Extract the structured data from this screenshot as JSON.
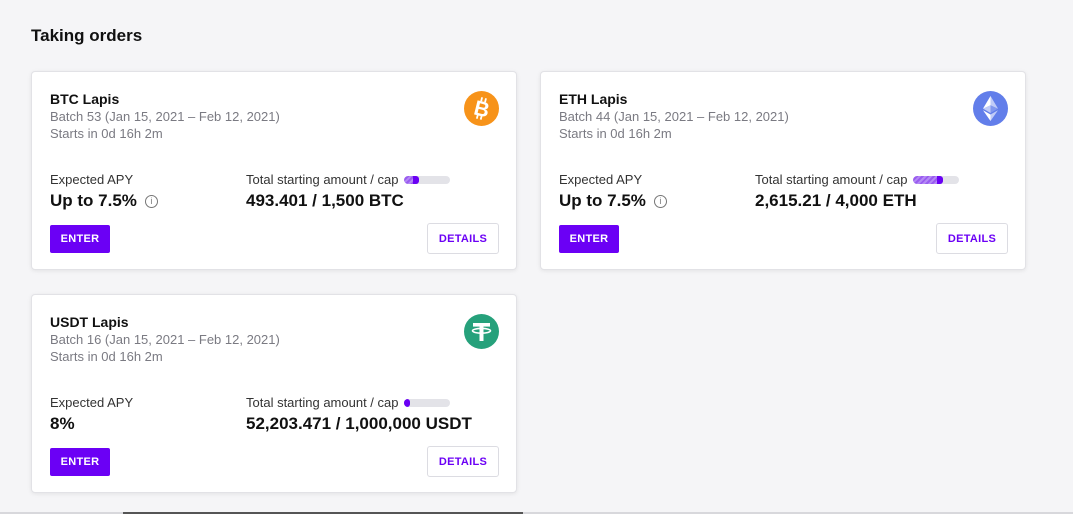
{
  "section": {
    "title": "Taking orders"
  },
  "cards": [
    {
      "name": "BTC Lapis",
      "batch": "Batch 53 (Jan 15, 2021 – Feb 12, 2021)",
      "starts": "Starts in 0d 16h 2m",
      "apy_label": "Expected APY",
      "apy_value": "Up to 7.5%",
      "cap_label": "Total starting amount / cap",
      "cap_value": "493.401 / 1,500 BTC",
      "progress_fraction": 0.33,
      "enter_label": "ENTER",
      "details_label": "DETAILS",
      "icon": "bitcoin-icon",
      "icon_color": "#f7931a",
      "show_info": true
    },
    {
      "name": "ETH Lapis",
      "batch": "Batch 44 (Jan 15, 2021 – Feb 12, 2021)",
      "starts": "Starts in 0d 16h 2m",
      "apy_label": "Expected APY",
      "apy_value": "Up to 7.5%",
      "cap_label": "Total starting amount / cap",
      "cap_value": "2,615.21 / 4,000 ETH",
      "progress_fraction": 0.65,
      "enter_label": "ENTER",
      "details_label": "DETAILS",
      "icon": "ethereum-icon",
      "icon_color": "#627eea",
      "show_info": true
    },
    {
      "name": "USDT Lapis",
      "batch": "Batch 16 (Jan 15, 2021 – Feb 12, 2021)",
      "starts": "Starts in 0d 16h 2m",
      "apy_label": "Expected APY",
      "apy_value": "8%",
      "cap_label": "Total starting amount / cap",
      "cap_value": "52,203.471 / 1,000,000 USDT",
      "progress_fraction": 0.052,
      "enter_label": "ENTER",
      "details_label": "DETAILS",
      "icon": "tether-icon",
      "icon_color": "#26a17b",
      "show_info": false
    }
  ],
  "colors": {
    "accent": "#6b00f5",
    "background": "#f5f5f7"
  }
}
